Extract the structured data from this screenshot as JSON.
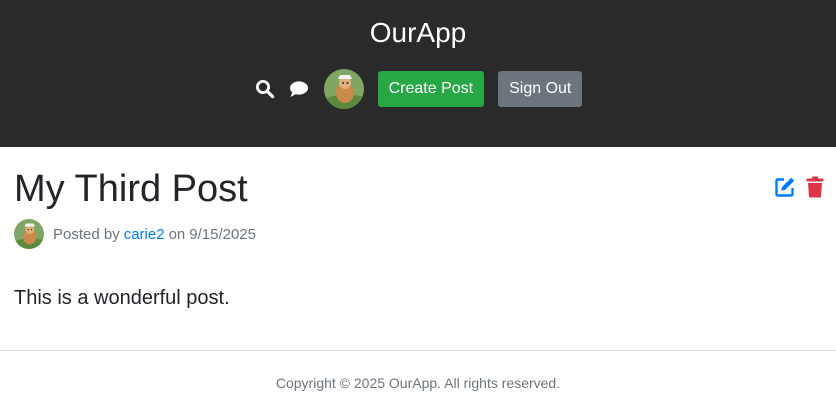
{
  "header": {
    "brand": "OurApp",
    "nav": {
      "search_icon": "search-icon",
      "chat_icon": "chat-icon",
      "create_post_label": "Create Post",
      "sign_out_label": "Sign Out"
    }
  },
  "post": {
    "title": "My Third Post",
    "meta": {
      "posted_by_prefix": "Posted by",
      "author": "carie2",
      "on_text": "on",
      "date": "9/15/2025"
    },
    "body": "This is a wonderful post.",
    "actions": {
      "edit_icon": "edit-icon",
      "delete_icon": "delete-icon"
    }
  },
  "footer": {
    "copyright": "Copyright © 2025 OurApp. All rights reserved."
  },
  "colors": {
    "header_bg": "#2a2a2a",
    "create_button": "#28a745",
    "sign_out_button": "#6c757d",
    "link": "#007bff",
    "edit_icon": "#007bff",
    "delete_icon": "#dc3545"
  }
}
